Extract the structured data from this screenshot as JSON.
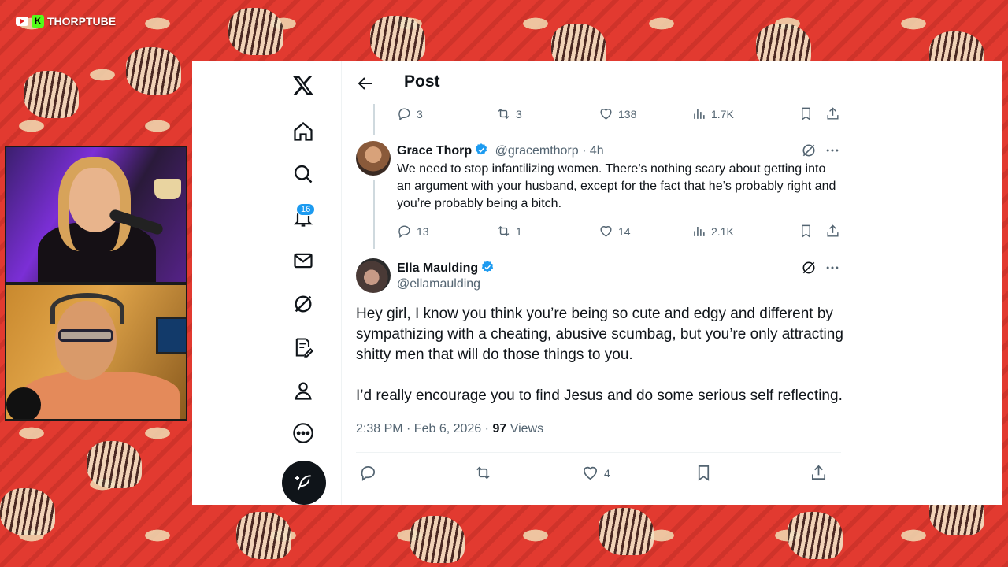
{
  "brand": {
    "name": "THORPTUBE",
    "k_letter": "K",
    "colors": {
      "kick": "#53fc18",
      "wallpaper": "#e23a30"
    }
  },
  "nav": {
    "notifications_count": "16",
    "icons": [
      "x-logo-icon",
      "home-icon",
      "search-icon",
      "bell-icon",
      "mail-icon",
      "grok-icon",
      "compose-icon",
      "profile-icon",
      "more-circle-icon",
      "post-feather-icon"
    ]
  },
  "header": {
    "title": "Post"
  },
  "prev_tweet": {
    "replies": "3",
    "reposts": "3",
    "likes": "138",
    "views": "1.7K"
  },
  "reply_tweet": {
    "name": "Grace Thorp",
    "handle": "@gracemthorp",
    "time": "· 4h",
    "text": "We need to stop infantilizing women. There’s nothing scary about getting into an argument with your husband, except for the fact that he’s probably right and you’re probably being a bitch.",
    "replies": "13",
    "reposts": "1",
    "likes": "14",
    "views": "2.1K"
  },
  "main_tweet": {
    "name": "Ella Maulding",
    "handle": "@ellamaulding",
    "paragraph1": "Hey girl, I know you think you’re being so cute and edgy and different by sympathizing with a cheating, abusive scumbag, but you’re only attracting shitty men that will do those things to you.",
    "paragraph2": "I’d really encourage you to find Jesus and do some serious self reflecting.",
    "timestamp": "2:38 PM · Feb 6, 2026 ·",
    "views_count": "97",
    "views_label": "Views",
    "likes": "4"
  },
  "colors": {
    "verified": "#1d9bf0",
    "text": "#0f1419",
    "muted": "#536471"
  }
}
